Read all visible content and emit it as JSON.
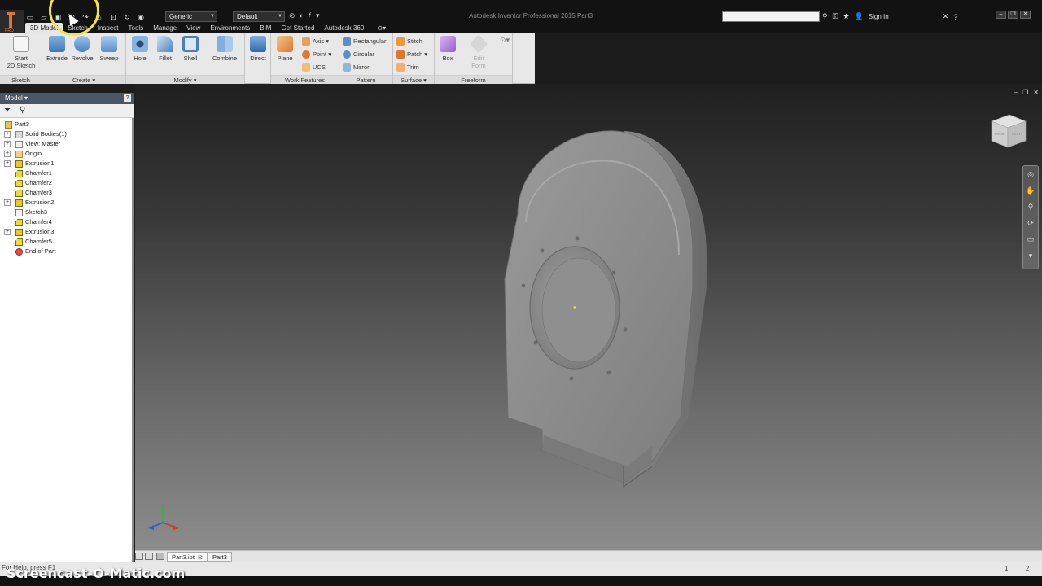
{
  "titlebar": {
    "title": "Autodesk Inventor Professional 2015    Part3",
    "material_combo": "Generic",
    "appearance_combo": "Default",
    "search_placeholder": "",
    "sign_in": "Sign In",
    "app_badge": "PRO"
  },
  "tabs": [
    {
      "label": "3D Model",
      "active": true
    },
    {
      "label": "Sketch"
    },
    {
      "label": "Inspect"
    },
    {
      "label": "Tools"
    },
    {
      "label": "Manage"
    },
    {
      "label": "View"
    },
    {
      "label": "Environments"
    },
    {
      "label": "BIM"
    },
    {
      "label": "Get Started"
    },
    {
      "label": "Autodesk 360"
    }
  ],
  "ribbon": {
    "panels": {
      "sketch": "Sketch",
      "create": "Create ▾",
      "modify": "Modify ▾",
      "work_features": "Work Features",
      "pattern": "Pattern",
      "surface": "Surface ▾",
      "freeform": "Freeform"
    },
    "tools": {
      "start_sketch": "Start\n2D Sketch",
      "extrude": "Extrude",
      "revolve": "Revolve",
      "sweep": "Sweep",
      "hole": "Hole",
      "fillet": "Fillet",
      "shell": "Shell",
      "combine": "Combine",
      "direct": "Direct",
      "plane": "Plane",
      "axis": "Axis",
      "point": "Point",
      "ucs": "UCS",
      "rectangular": "Rectangular",
      "circular": "Circular",
      "mirror": "Mirror",
      "stitch": "Stitch",
      "patch": "Patch",
      "trim": "Trim",
      "box": "Box",
      "edit_form": "Edit\nForm"
    }
  },
  "browser": {
    "title": "Model ▾",
    "tree": [
      {
        "label": "Part3",
        "root": true,
        "icon": "part-icon"
      },
      {
        "label": "Solid Bodies(1)",
        "expandable": true,
        "icon": "folder-icon"
      },
      {
        "label": "View: Master",
        "expandable": true,
        "icon": "view-icon"
      },
      {
        "label": "Origin",
        "expandable": true,
        "icon": "folder-icon"
      },
      {
        "label": "Extrusion1",
        "expandable": true,
        "icon": "extrusion-icon"
      },
      {
        "label": "Chamfer1",
        "icon": "chamfer-icon"
      },
      {
        "label": "Chamfer2",
        "icon": "chamfer-icon"
      },
      {
        "label": "Chamfer3",
        "icon": "chamfer-icon"
      },
      {
        "label": "Extrusion2",
        "expandable": true,
        "icon": "extrusion-icon"
      },
      {
        "label": "Sketch3",
        "icon": "sketch-icon"
      },
      {
        "label": "Chamfer4",
        "icon": "chamfer-icon"
      },
      {
        "label": "Extrusion3",
        "expandable": true,
        "icon": "extrusion-icon"
      },
      {
        "label": "Chamfer5",
        "icon": "chamfer-icon"
      },
      {
        "label": "End of Part",
        "icon": "end-of-part-icon"
      }
    ]
  },
  "viewcube": {
    "face_top": "FRONT",
    "face_side": "RIGHT"
  },
  "document_tabs": [
    {
      "label": "Part3.ipt",
      "active": true
    },
    {
      "label": "Part3"
    }
  ],
  "statusbar": {
    "text": "For Help, press F1",
    "count1": "1",
    "count2": "2"
  },
  "watermark": "Screencast-O-Matic.com",
  "colors": {
    "app_accent": "#e0772a",
    "browser_header": "#4b5764",
    "cursor_highlight": "#f5e63a"
  }
}
